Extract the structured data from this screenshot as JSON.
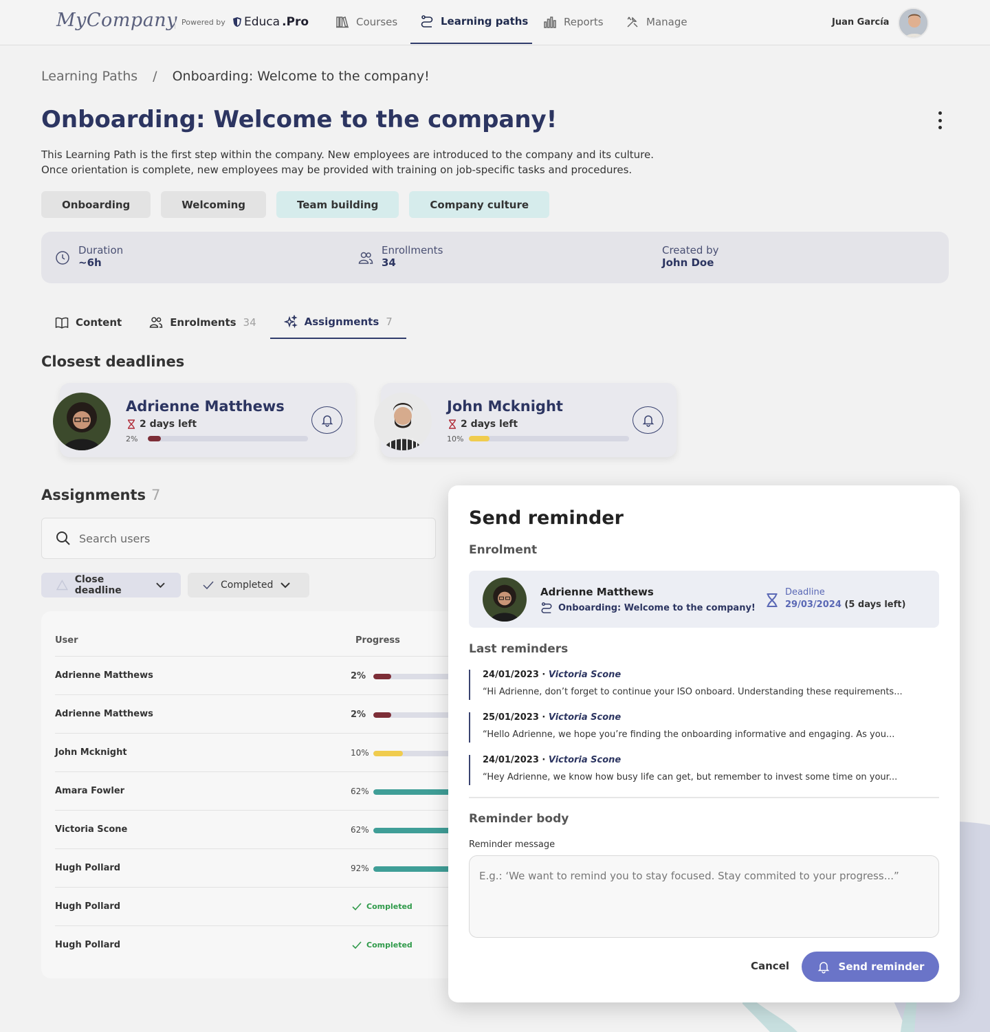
{
  "topbar": {
    "logo": "MyCompany",
    "powered_by": "Powered by",
    "brand": "Educa",
    "brand_suffix": ".Pro",
    "nav": [
      {
        "label": "Courses",
        "icon": "library-icon"
      },
      {
        "label": "Learning paths",
        "icon": "route-icon"
      },
      {
        "label": "Reports",
        "icon": "bar-chart-icon"
      },
      {
        "label": "Manage",
        "icon": "tools-icon"
      }
    ],
    "user_name": "Juan García"
  },
  "breadcrumb": {
    "root": "Learning Paths",
    "separator": "/",
    "current": "Onboarding: Welcome to the company!"
  },
  "page": {
    "title": "Onboarding: Welcome to the company!",
    "description_1": "This Learning Path is the first step within the company. New employees are introduced to the company and its culture.",
    "description_2": "Once orientation is complete, new employees may be provided with training on job-specific tasks and procedures.",
    "tags": [
      "Onboarding",
      "Welcoming",
      "Team building",
      "Company culture"
    ]
  },
  "stats": {
    "duration_label": "Duration",
    "duration_value": "~6h",
    "enrollments_label": "Enrollments",
    "enrollments_value": "34",
    "created_label": "Created by",
    "created_value": "John Doe"
  },
  "tabs": [
    {
      "label": "Content",
      "count": ""
    },
    {
      "label": "Enrolments",
      "count": "34"
    },
    {
      "label": "Assignments",
      "count": "7"
    }
  ],
  "closest_deadlines": {
    "title": "Closest deadlines",
    "cards": [
      {
        "name": "Adrienne Matthews",
        "left": "2 days left",
        "percent": "2%",
        "progress": 0.08,
        "color": "#7d2e37"
      },
      {
        "name": "John Mcknight",
        "left": "2 days left",
        "percent": "10%",
        "progress": 0.13,
        "color": "#f0cc4e"
      }
    ]
  },
  "assignments": {
    "title": "Assignments",
    "count": "7",
    "search_placeholder": "Search users",
    "filter_1": "Close deadline",
    "filter_2": "Completed",
    "col_user": "User",
    "col_progress": "Progress",
    "rows": [
      {
        "user": "Adrienne Matthews",
        "percent": "2%",
        "progress": 0.16,
        "color": "#7d2e37"
      },
      {
        "user": "Adrienne Matthews",
        "percent": "2%",
        "progress": 0.16,
        "color": "#7d2e37"
      },
      {
        "user": "John Mcknight",
        "percent": "10%",
        "progress": 0.27,
        "color": "#f0cc4e"
      },
      {
        "user": "Amara Fowler",
        "percent": "62%",
        "progress": 1.0,
        "color": "#3f9e97"
      },
      {
        "user": "Victoria Scone",
        "percent": "62%",
        "progress": 1.0,
        "color": "#3f9e97"
      },
      {
        "user": "Hugh Pollard",
        "percent": "92%",
        "progress": 1.0,
        "color": "#3f9e97"
      },
      {
        "user": "Hugh Pollard",
        "completed": "Completed"
      },
      {
        "user": "Hugh Pollard",
        "completed": "Completed"
      }
    ]
  },
  "modal": {
    "title": "Send reminder",
    "enrolment_label": "Enrolment",
    "enrol_name": "Adrienne Matthews",
    "enrol_path": "Onboarding: Welcome to the company!",
    "deadline_label": "Deadline",
    "deadline_date": "29/03/2024",
    "deadline_left": "(5 days left)",
    "last_reminders_label": "Last reminders",
    "reminders": [
      {
        "date": "24/01/2023",
        "author": "Victoria Scone",
        "message": "“Hi Adrienne, don’t forget to continue your ISO onboard. Understanding these requirements..."
      },
      {
        "date": "25/01/2023",
        "author": "Victoria Scone",
        "message": "“Hello Adrienne, we hope you’re finding the onboarding informative and engaging. As you..."
      },
      {
        "date": "24/01/2023",
        "author": "Victoria Scone",
        "message": "“Hey Adrienne, we know how busy life can get, but remember to invest some time on your..."
      }
    ],
    "body_label": "Reminder body",
    "message_label": "Reminder message",
    "message_placeholder": "E.g.: ‘We want to remind you to stay focused. Stay commited to your progress...”",
    "cancel": "Cancel",
    "send": "Send reminder"
  },
  "colors": {
    "primary": "#2c3561",
    "button": "#6a74c8",
    "teal_tag": "#d6ecec",
    "success": "#2f9a4a"
  }
}
